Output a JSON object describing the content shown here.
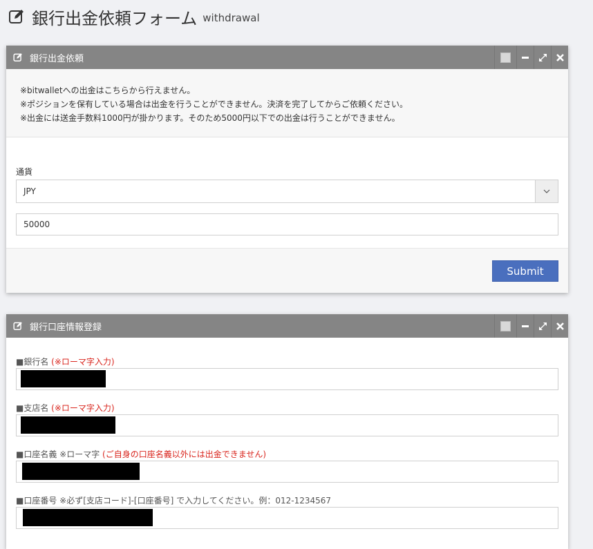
{
  "header": {
    "icon": "edit-icon",
    "title": "銀行出金依頼フォーム",
    "subtitle": "withdrawal"
  },
  "withdraw_panel": {
    "title": "銀行出金依頼",
    "notices": [
      "※bitwalletへの出金はこちらから行えません。",
      "※ポジションを保有している場合は出金を行うことができません。決済を完了してからご依頼ください。",
      "※出金には送金手数料1000円が掛かります。そのため5000円以下での出金は行うことができません。"
    ],
    "currency_label": "通貨",
    "currency_value": "JPY",
    "amount_value": "50000",
    "submit_label": "Submit"
  },
  "bank_panel": {
    "title": "銀行口座情報登録",
    "fields": [
      {
        "label": "■銀行名",
        "note": "(※ローマ字入力)"
      },
      {
        "label": "■支店名",
        "note": "(※ローマ字入力)"
      },
      {
        "label": "■口座名義 ※ローマ字",
        "note": "(ご自身の口座名義以外には出金できません)"
      },
      {
        "label": "■口座番号 ※必ず[支店コード]-[口座番号] で入力してください。例：012-1234567",
        "note": ""
      }
    ]
  },
  "colors": {
    "panel_header": "#858585",
    "submit": "#4a6fbe",
    "required_note": "#d9251d",
    "page_bg": "#f0f1f4"
  }
}
